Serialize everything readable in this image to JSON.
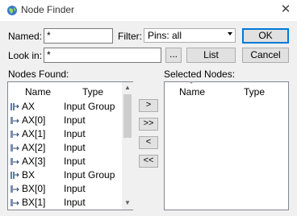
{
  "window": {
    "title": "Node Finder",
    "close_glyph": "✕"
  },
  "fields": {
    "named_label": "Named:",
    "named_value": "*",
    "filter_label": "Filter:",
    "filter_value": "Pins: all",
    "look_in_label": "Look in:",
    "look_in_value": "*",
    "browse_label": "..."
  },
  "buttons": {
    "ok": "OK",
    "list": "List",
    "cancel": "Cancel",
    "add": ">",
    "add_all": ">>",
    "remove": "<",
    "remove_all": "<<"
  },
  "nodes_found": {
    "label": "Nodes Found:",
    "columns": [
      "Name",
      "Type"
    ],
    "rows": [
      {
        "name": "AX",
        "type": "Input Group",
        "icon": "input-group-icon"
      },
      {
        "name": "AX[0]",
        "type": "Input",
        "icon": "input-pin-icon"
      },
      {
        "name": "AX[1]",
        "type": "Input",
        "icon": "input-pin-icon"
      },
      {
        "name": "AX[2]",
        "type": "Input",
        "icon": "input-pin-icon"
      },
      {
        "name": "AX[3]",
        "type": "Input",
        "icon": "input-pin-icon"
      },
      {
        "name": "BX",
        "type": "Input Group",
        "icon": "input-group-icon"
      },
      {
        "name": "BX[0]",
        "type": "Input",
        "icon": "input-pin-icon"
      },
      {
        "name": "BX[1]",
        "type": "Input",
        "icon": "input-pin-icon"
      }
    ]
  },
  "selected_nodes": {
    "label": "Selected Nodes:",
    "columns": [
      "Name",
      "Type"
    ],
    "rows": []
  },
  "colors": {
    "default_button_border": "#0078d7",
    "dialog_background": "#f0f0f0"
  }
}
